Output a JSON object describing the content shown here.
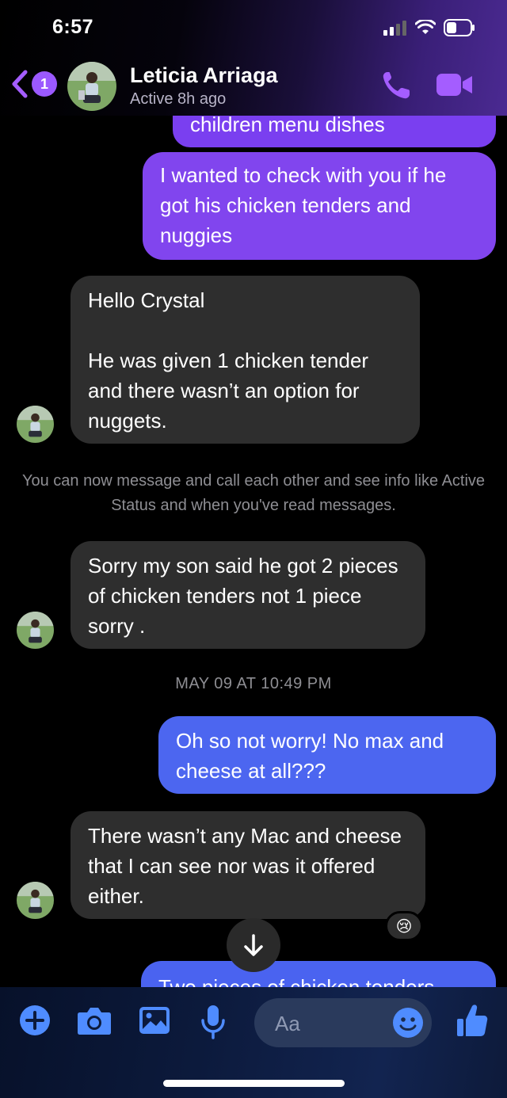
{
  "status_bar": {
    "time": "6:57"
  },
  "header": {
    "back_badge": "1",
    "contact_name": "Leticia Arriaga",
    "contact_status": "Active 8h ago"
  },
  "messages": [
    {
      "direction": "outgoing",
      "text": "children menu dishes"
    },
    {
      "direction": "outgoing",
      "text": "I wanted to check with you if he got his chicken tenders and nuggies"
    },
    {
      "direction": "incoming",
      "text": "Hello Crystal\n\nHe was given 1 chicken tender and there wasn’t an option for nuggets."
    },
    {
      "direction": "incoming",
      "text": "Sorry my son said he got 2 pieces of chicken tenders not 1 piece sorry ."
    },
    {
      "direction": "outgoing",
      "text": "Oh so not worry! No max and cheese at all???"
    },
    {
      "direction": "incoming",
      "text": "There wasn’t any Mac and cheese that I can see nor was it offered either."
    },
    {
      "direction": "outgoing",
      "text": "Two pieces of chicken tenders"
    }
  ],
  "system_note": "You can now message and call each other and see info like Active Status and when you've read messages.",
  "timestamp": "MAY 09 AT 10:49 PM",
  "reaction": "😢",
  "composer": {
    "placeholder": "Aa"
  },
  "colors": {
    "accent_purple": "#8145ee",
    "accent_blue": "#4c66f0",
    "incoming_bubble": "#2e2e2e",
    "icon_blue": "#4f8cff"
  }
}
